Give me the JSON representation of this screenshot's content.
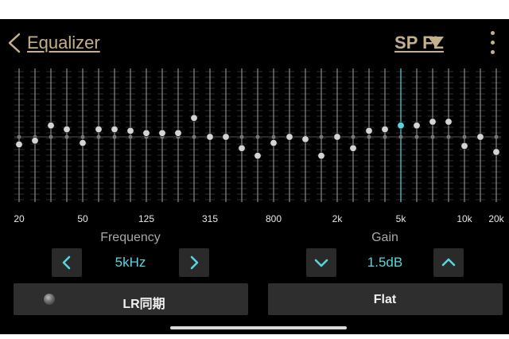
{
  "header": {
    "title": "Equalizer",
    "channel": "SP FL",
    "back_icon": "chevron-left-icon",
    "channel_icon": "triangle-down-icon",
    "menu_icon": "more-vertical-icon"
  },
  "colors": {
    "accent_gold": "#c4b08a",
    "value_cyan": "#55d6de",
    "selected_knob": "#55d6de"
  },
  "equalizer": {
    "selected_band_index": 24,
    "gain_range_db": [
      -12,
      12
    ],
    "bands": [
      {
        "label": "20",
        "gain_db": -1.0
      },
      {
        "label": "",
        "gain_db": -0.5
      },
      {
        "label": "",
        "gain_db": 1.5
      },
      {
        "label": "",
        "gain_db": 1.0
      },
      {
        "label": "50",
        "gain_db": -0.8
      },
      {
        "label": "",
        "gain_db": 1.0
      },
      {
        "label": "",
        "gain_db": 1.0
      },
      {
        "label": "",
        "gain_db": 0.8
      },
      {
        "label": "125",
        "gain_db": 0.5
      },
      {
        "label": "",
        "gain_db": 0.5
      },
      {
        "label": "",
        "gain_db": 0.5
      },
      {
        "label": "",
        "gain_db": 2.5
      },
      {
        "label": "315",
        "gain_db": 0.0
      },
      {
        "label": "",
        "gain_db": 0.0
      },
      {
        "label": "",
        "gain_db": -1.5
      },
      {
        "label": "",
        "gain_db": -2.5
      },
      {
        "label": "800",
        "gain_db": -0.8
      },
      {
        "label": "",
        "gain_db": 0.0
      },
      {
        "label": "",
        "gain_db": -0.3
      },
      {
        "label": "",
        "gain_db": -2.5
      },
      {
        "label": "2k",
        "gain_db": 0.0
      },
      {
        "label": "",
        "gain_db": -1.5
      },
      {
        "label": "",
        "gain_db": 0.8
      },
      {
        "label": "",
        "gain_db": 1.0
      },
      {
        "label": "5k",
        "gain_db": 1.5
      },
      {
        "label": "",
        "gain_db": 1.5
      },
      {
        "label": "",
        "gain_db": 2.0
      },
      {
        "label": "",
        "gain_db": 2.0
      },
      {
        "label": "10k",
        "gain_db": -1.2
      },
      {
        "label": "",
        "gain_db": 0.0
      },
      {
        "label": "20k",
        "gain_db": -2.0
      }
    ]
  },
  "frequency": {
    "title": "Frequency",
    "value": "5kHz",
    "dec_icon": "chevron-left-icon",
    "inc_icon": "chevron-right-icon"
  },
  "gain": {
    "title": "Gain",
    "value": "1.5dB",
    "dec_icon": "chevron-down-icon",
    "inc_icon": "chevron-up-icon"
  },
  "buttons": {
    "lr_sync": "LR同期",
    "flat": "Flat"
  }
}
